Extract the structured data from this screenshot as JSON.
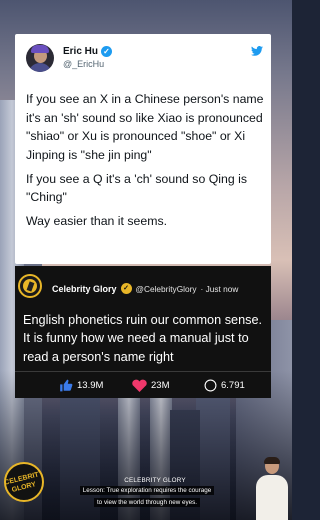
{
  "tweet": {
    "author_name": "Eric Hu",
    "handle": "@_EricHu",
    "verified_icon": "check-badge-icon",
    "platform_icon": "twitter-bird-icon",
    "paragraphs": [
      "If you see an X in a Chinese person's name it's an 'sh' sound so like Xiao is pronounced \"shiao\" or Xu is pronounced \"shoe\" or Xi Jinping is \"she jin ping\"",
      "If you see a Q it's a 'ch' sound so Qing is \"Ching\"",
      "Way easier than it seems."
    ]
  },
  "comment": {
    "account_name": "Celebrity Glory",
    "handle": "@CelebrityGlory",
    "time": "· Just now",
    "text": "English phonetics ruin our common sense. It is funny how we need a manual just to read a person's name right",
    "stats": {
      "likes": "13.9M",
      "hearts": "23M",
      "comments": "6.791"
    }
  },
  "footer": {
    "title": "CELEBRITY GLORY",
    "lesson_line1": "Lesson: True exploration requires the courage",
    "lesson_line2": "to view the world through new eyes.",
    "logo_word1": "CELEBRITY",
    "logo_word2": "GLORY"
  },
  "colors": {
    "accent_gold": "#e8b628",
    "twitter_blue": "#1d9bf0",
    "like_blue": "#3b7bea",
    "heart_pink": "#f0386b"
  }
}
